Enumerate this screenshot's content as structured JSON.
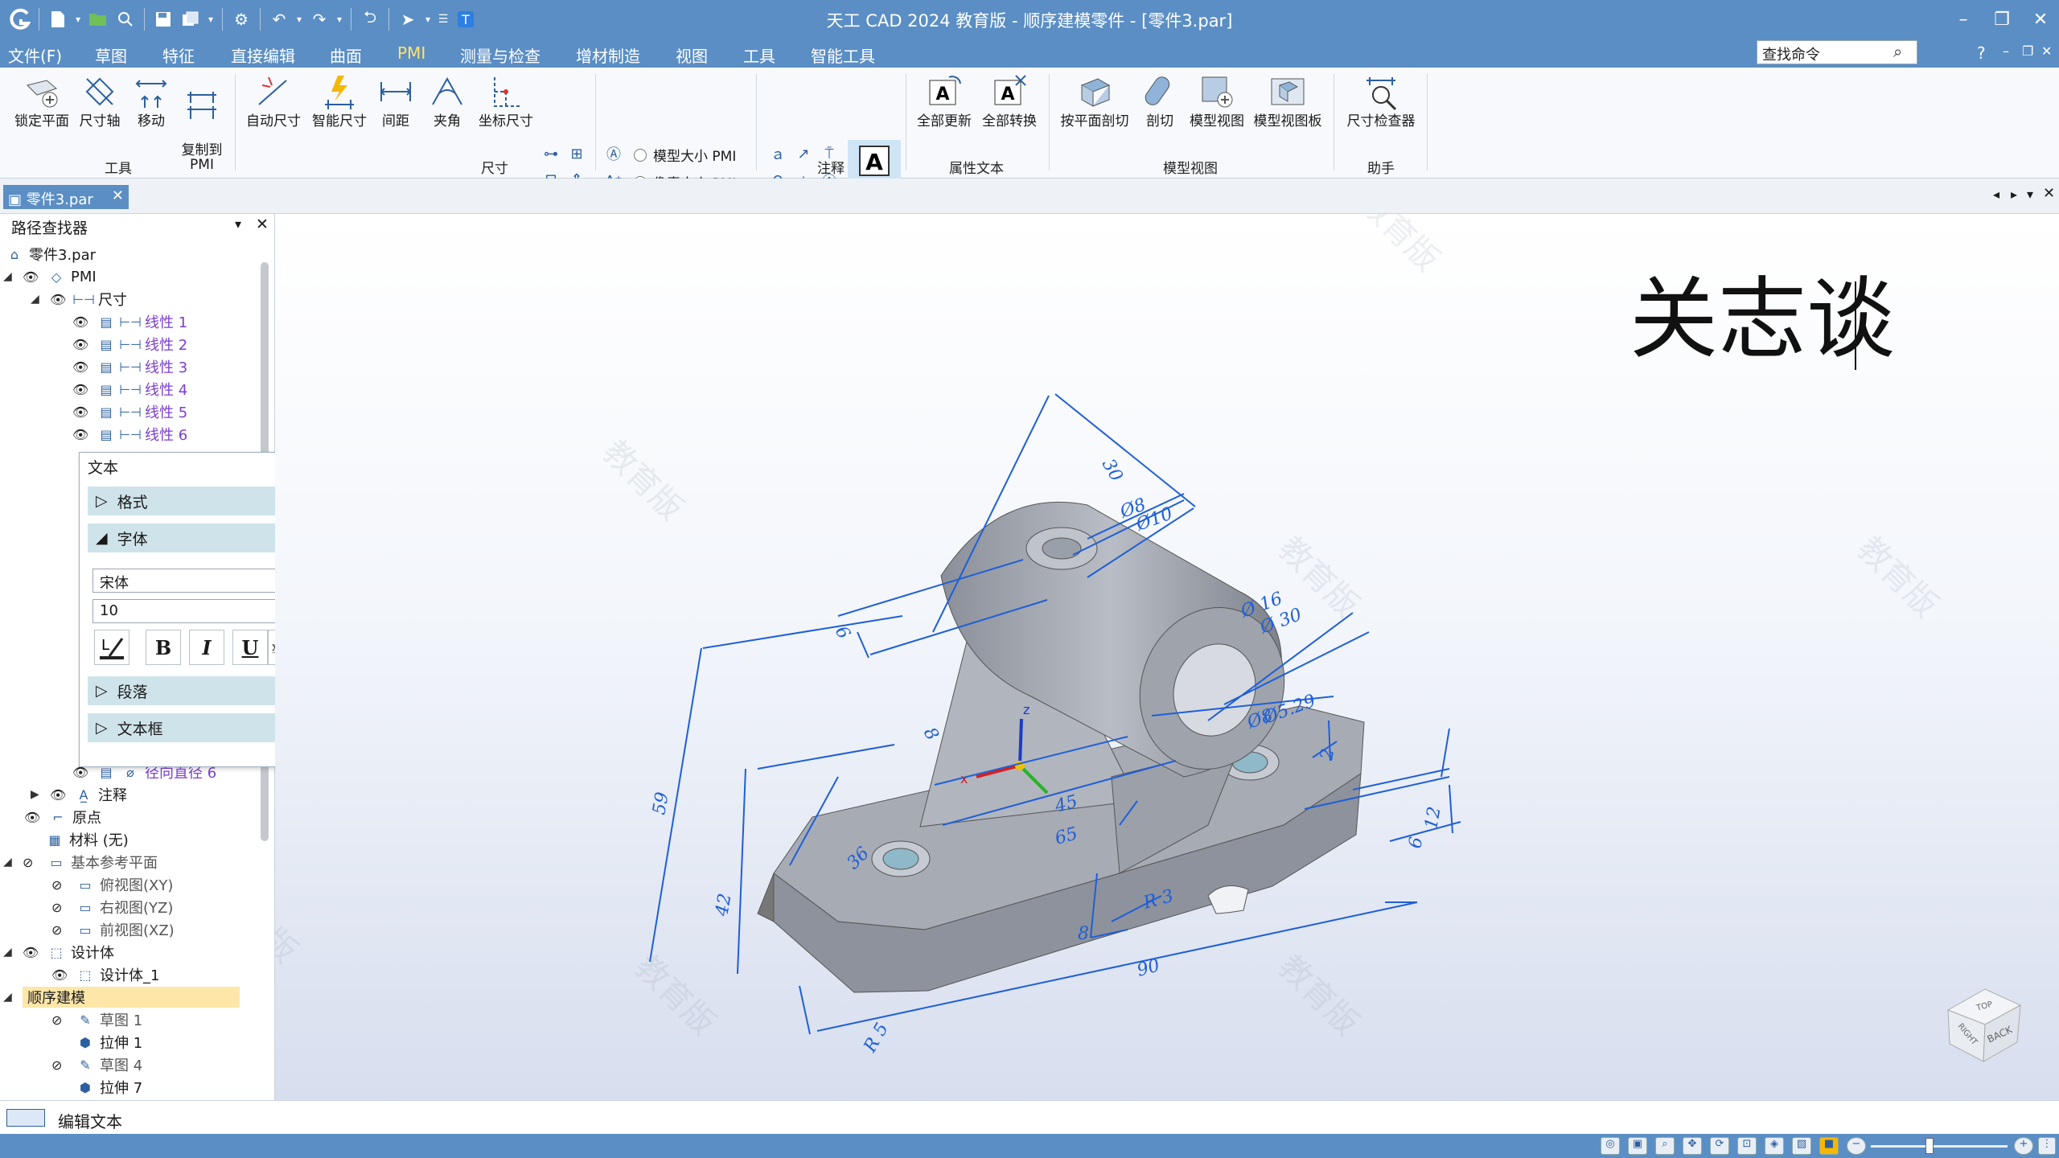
{
  "window": {
    "title": "天工 CAD 2024 教育版 - 顺序建模零件 - [零件3.par]"
  },
  "menu": {
    "items": [
      "文件(F)",
      "草图",
      "特征",
      "直接编辑",
      "曲面",
      "PMI",
      "测量与检查",
      "增材制造",
      "视图",
      "工具",
      "智能工具"
    ],
    "active": "PMI",
    "search_placeholder": "查找命令"
  },
  "ribbon": {
    "tools": {
      "buttons": [
        "锁定平面",
        "尺寸轴",
        "移动",
        "复制到\nPMI"
      ],
      "label": "工具"
    },
    "dimension": {
      "buttons": [
        "自动尺寸",
        "智能尺寸",
        "间距",
        "夹角",
        "坐标尺寸"
      ],
      "label": "尺寸"
    },
    "pmi_size": {
      "model": "模型大小 PMI",
      "pixel": "像素大小 PMI"
    },
    "annotation": {
      "text_button": "文本",
      "label": "注释"
    },
    "attr_text": {
      "buttons": [
        "全部更新",
        "全部转换"
      ],
      "label": "属性文本"
    },
    "model_view": {
      "buttons": [
        "按平面剖切",
        "剖切",
        "模型视图",
        "模型视图板"
      ],
      "label": "模型视图"
    },
    "helper": {
      "buttons": [
        "尺寸检查器"
      ],
      "label": "助手"
    }
  },
  "doc_tab": {
    "label": "零件3.par"
  },
  "pathfinder": {
    "title": "路径查找器",
    "root": "零件3.par",
    "pmi": "PMI",
    "dims": "尺寸",
    "linear": [
      "线性 1",
      "线性 2",
      "线性 3",
      "线性 4",
      "线性 5",
      "线性 6"
    ],
    "radial": "径向直径 6",
    "notes": "注释",
    "origin": "原点",
    "material": "材料 (无)",
    "base_planes": "基本参考平面",
    "planes": [
      "俯视图(XY)",
      "右视图(YZ)",
      "前视图(XZ)"
    ],
    "design_body": "设计体",
    "design_body_1": "设计体_1",
    "seq_model": "顺序建模",
    "features": [
      "草图 1",
      "拉伸 1",
      "草图 4",
      "拉伸 7"
    ]
  },
  "text_dialog": {
    "title": "文本",
    "sections": {
      "format": "格式",
      "font": "字体",
      "paragraph": "段落",
      "textbox": "文本框"
    },
    "font_name": "宋体",
    "font_size": "10",
    "bold": "B",
    "italic": "I",
    "underline": "U"
  },
  "viewport": {
    "annotation_text": "关志谈",
    "watermark": "教育版",
    "dimensions": [
      "30",
      "Ø8",
      "Ø10",
      "6",
      "Ø 16",
      "Ø 30",
      "59",
      "8",
      "Ø8",
      "Ø5.29",
      "2",
      "45",
      "65",
      "36",
      "42",
      "12",
      "6",
      "R 3",
      "8",
      "90",
      "R 5"
    ],
    "viewcube": {
      "top": "TOP",
      "right": "RIGHT",
      "back": "BACK"
    }
  },
  "status": {
    "text": "编辑文本"
  },
  "colors": {
    "title_bar": "#5b8ec4",
    "active_menu": "#ffe36b",
    "dimension": "#1f5fd6",
    "link_purple": "#7a3fd0",
    "section_bg": "#cfe4ea",
    "selected_row": "#fde6a8"
  }
}
